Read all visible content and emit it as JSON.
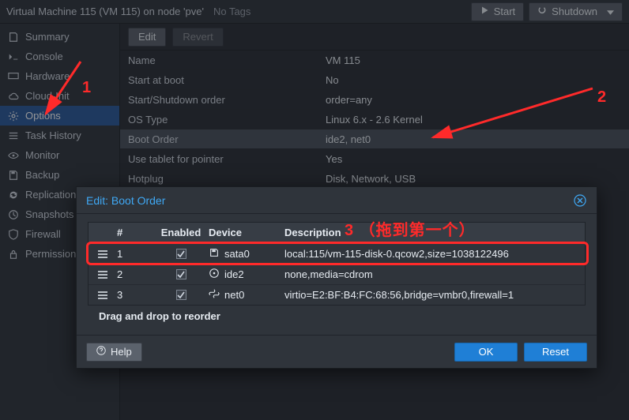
{
  "topbar": {
    "title": "Virtual Machine 115 (VM 115) on node 'pve'",
    "notags": "No Tags",
    "start": "Start",
    "shutdown": "Shutdown"
  },
  "sidebar": {
    "items": [
      {
        "label": "Summary"
      },
      {
        "label": "Console"
      },
      {
        "label": "Hardware"
      },
      {
        "label": "Cloud-Init"
      },
      {
        "label": "Options"
      },
      {
        "label": "Task History"
      },
      {
        "label": "Monitor"
      },
      {
        "label": "Backup"
      },
      {
        "label": "Replication"
      },
      {
        "label": "Snapshots"
      },
      {
        "label": "Firewall"
      },
      {
        "label": "Permissions"
      }
    ]
  },
  "toolbar": {
    "edit": "Edit",
    "revert": "Revert"
  },
  "props": [
    {
      "k": "Name",
      "v": "VM 115"
    },
    {
      "k": "Start at boot",
      "v": "No"
    },
    {
      "k": "Start/Shutdown order",
      "v": "order=any"
    },
    {
      "k": "OS Type",
      "v": "Linux 6.x - 2.6 Kernel"
    },
    {
      "k": "Boot Order",
      "v": "ide2, net0"
    },
    {
      "k": "Use tablet for pointer",
      "v": "Yes"
    },
    {
      "k": "Hotplug",
      "v": "Disk, Network, USB"
    }
  ],
  "modal": {
    "title": "Edit: Boot Order",
    "headers": {
      "num": "#",
      "enabled": "Enabled",
      "device": "Device",
      "description": "Description"
    },
    "rows": [
      {
        "num": "1",
        "enabled": true,
        "device": "sata0",
        "desc": "local:115/vm-115-disk-0.qcow2,size=1038122496",
        "icon": "disk"
      },
      {
        "num": "2",
        "enabled": true,
        "device": "ide2",
        "desc": "none,media=cdrom",
        "icon": "cd"
      },
      {
        "num": "3",
        "enabled": true,
        "device": "net0",
        "desc": "virtio=E2:BF:B4:FC:68:56,bridge=vmbr0,firewall=1",
        "icon": "net"
      }
    ],
    "drag_hint": "Drag and drop to reorder",
    "help": "Help",
    "ok": "OK",
    "reset": "Reset"
  },
  "annotations": {
    "a1": "1",
    "a2": "2",
    "a3": "3  （拖到第一个）"
  }
}
